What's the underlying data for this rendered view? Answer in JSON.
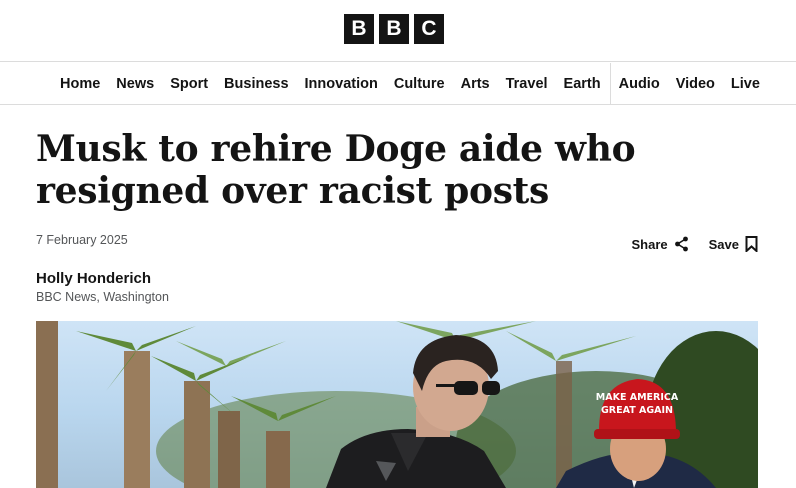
{
  "brand": {
    "letters": [
      "B",
      "B",
      "C"
    ]
  },
  "nav": {
    "items": [
      "Home",
      "News",
      "Sport",
      "Business",
      "Innovation",
      "Culture",
      "Arts",
      "Travel",
      "Earth",
      "Audio",
      "Video",
      "Live"
    ]
  },
  "article": {
    "headline": "Musk to rehire Doge aide who resigned over racist posts",
    "date": "7 February 2025",
    "author": "Holly Honderich",
    "author_role": "BBC News, Washington",
    "hat_text_line1": "MAKE AMERICA",
    "hat_text_line2": "GREAT AGAIN"
  },
  "actions": {
    "share_label": "Share",
    "save_label": "Save"
  },
  "colors": {
    "ink": "#141414",
    "muted": "#545658",
    "rule": "#dcdcdc",
    "hat_red": "#c8161d"
  }
}
